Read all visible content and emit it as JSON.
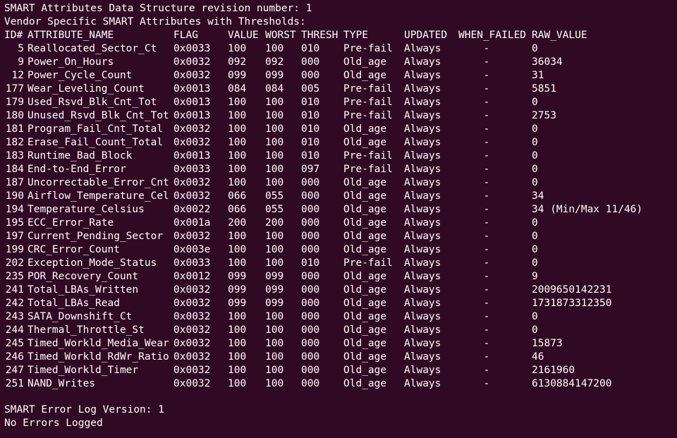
{
  "terminal": {
    "background": "#300a24",
    "foreground": "#ffffff",
    "lines_top": [
      "SMART Attributes Data Structure revision number: 1",
      "Vendor Specific SMART Attributes with Thresholds:"
    ],
    "header": {
      "id": "ID#",
      "name": "ATTRIBUTE_NAME",
      "flag": "FLAG",
      "value": "VALUE",
      "worst": "WORST",
      "thresh": "THRESH",
      "type": "TYPE",
      "updated": "UPDATED",
      "when_failed": "WHEN_FAILED",
      "raw": "RAW_VALUE"
    },
    "rows": [
      {
        "id": "5",
        "name": "Reallocated_Sector_Ct",
        "flag": "0x0033",
        "value": "100",
        "worst": "100",
        "thresh": "010",
        "type": "Pre-fail",
        "updated": "Always",
        "when_failed": "-",
        "raw": "0"
      },
      {
        "id": "9",
        "name": "Power_On_Hours",
        "flag": "0x0032",
        "value": "092",
        "worst": "092",
        "thresh": "000",
        "type": "Old_age",
        "updated": "Always",
        "when_failed": "-",
        "raw": "36034"
      },
      {
        "id": "12",
        "name": "Power_Cycle_Count",
        "flag": "0x0032",
        "value": "099",
        "worst": "099",
        "thresh": "000",
        "type": "Old_age",
        "updated": "Always",
        "when_failed": "-",
        "raw": "31"
      },
      {
        "id": "177",
        "name": "Wear_Leveling_Count",
        "flag": "0x0013",
        "value": "084",
        "worst": "084",
        "thresh": "005",
        "type": "Pre-fail",
        "updated": "Always",
        "when_failed": "-",
        "raw": "5851"
      },
      {
        "id": "179",
        "name": "Used_Rsvd_Blk_Cnt_Tot",
        "flag": "0x0013",
        "value": "100",
        "worst": "100",
        "thresh": "010",
        "type": "Pre-fail",
        "updated": "Always",
        "when_failed": "-",
        "raw": "0"
      },
      {
        "id": "180",
        "name": "Unused_Rsvd_Blk_Cnt_Tot",
        "flag": "0x0013",
        "value": "100",
        "worst": "100",
        "thresh": "010",
        "type": "Pre-fail",
        "updated": "Always",
        "when_failed": "-",
        "raw": "2753"
      },
      {
        "id": "181",
        "name": "Program_Fail_Cnt_Total",
        "flag": "0x0032",
        "value": "100",
        "worst": "100",
        "thresh": "010",
        "type": "Old_age",
        "updated": "Always",
        "when_failed": "-",
        "raw": "0"
      },
      {
        "id": "182",
        "name": "Erase_Fail_Count_Total",
        "flag": "0x0032",
        "value": "100",
        "worst": "100",
        "thresh": "010",
        "type": "Old_age",
        "updated": "Always",
        "when_failed": "-",
        "raw": "0"
      },
      {
        "id": "183",
        "name": "Runtime_Bad_Block",
        "flag": "0x0013",
        "value": "100",
        "worst": "100",
        "thresh": "010",
        "type": "Pre-fail",
        "updated": "Always",
        "when_failed": "-",
        "raw": "0"
      },
      {
        "id": "184",
        "name": "End-to-End_Error",
        "flag": "0x0033",
        "value": "100",
        "worst": "100",
        "thresh": "097",
        "type": "Pre-fail",
        "updated": "Always",
        "when_failed": "-",
        "raw": "0"
      },
      {
        "id": "187",
        "name": "Uncorrectable_Error_Cnt",
        "flag": "0x0032",
        "value": "100",
        "worst": "100",
        "thresh": "000",
        "type": "Old_age",
        "updated": "Always",
        "when_failed": "-",
        "raw": "0"
      },
      {
        "id": "190",
        "name": "Airflow_Temperature_Cel",
        "flag": "0x0032",
        "value": "066",
        "worst": "055",
        "thresh": "000",
        "type": "Old_age",
        "updated": "Always",
        "when_failed": "-",
        "raw": "34"
      },
      {
        "id": "194",
        "name": "Temperature_Celsius",
        "flag": "0x0022",
        "value": "066",
        "worst": "055",
        "thresh": "000",
        "type": "Old_age",
        "updated": "Always",
        "when_failed": "-",
        "raw": "34 (Min/Max 11/46)"
      },
      {
        "id": "195",
        "name": "ECC_Error_Rate",
        "flag": "0x001a",
        "value": "200",
        "worst": "200",
        "thresh": "000",
        "type": "Old_age",
        "updated": "Always",
        "when_failed": "-",
        "raw": "0"
      },
      {
        "id": "197",
        "name": "Current_Pending_Sector",
        "flag": "0x0032",
        "value": "100",
        "worst": "100",
        "thresh": "000",
        "type": "Old_age",
        "updated": "Always",
        "when_failed": "-",
        "raw": "0"
      },
      {
        "id": "199",
        "name": "CRC_Error_Count",
        "flag": "0x003e",
        "value": "100",
        "worst": "100",
        "thresh": "000",
        "type": "Old_age",
        "updated": "Always",
        "when_failed": "-",
        "raw": "0"
      },
      {
        "id": "202",
        "name": "Exception_Mode_Status",
        "flag": "0x0033",
        "value": "100",
        "worst": "100",
        "thresh": "010",
        "type": "Pre-fail",
        "updated": "Always",
        "when_failed": "-",
        "raw": "0"
      },
      {
        "id": "235",
        "name": "POR_Recovery_Count",
        "flag": "0x0012",
        "value": "099",
        "worst": "099",
        "thresh": "000",
        "type": "Old_age",
        "updated": "Always",
        "when_failed": "-",
        "raw": "9"
      },
      {
        "id": "241",
        "name": "Total_LBAs_Written",
        "flag": "0x0032",
        "value": "099",
        "worst": "099",
        "thresh": "000",
        "type": "Old_age",
        "updated": "Always",
        "when_failed": "-",
        "raw": "2009650142231"
      },
      {
        "id": "242",
        "name": "Total_LBAs_Read",
        "flag": "0x0032",
        "value": "099",
        "worst": "099",
        "thresh": "000",
        "type": "Old_age",
        "updated": "Always",
        "when_failed": "-",
        "raw": "1731873312350"
      },
      {
        "id": "243",
        "name": "SATA_Downshift_Ct",
        "flag": "0x0032",
        "value": "100",
        "worst": "100",
        "thresh": "000",
        "type": "Old_age",
        "updated": "Always",
        "when_failed": "-",
        "raw": "0"
      },
      {
        "id": "244",
        "name": "Thermal_Throttle_St",
        "flag": "0x0032",
        "value": "100",
        "worst": "100",
        "thresh": "000",
        "type": "Old_age",
        "updated": "Always",
        "when_failed": "-",
        "raw": "0"
      },
      {
        "id": "245",
        "name": "Timed_Workld_Media_Wear",
        "flag": "0x0032",
        "value": "100",
        "worst": "100",
        "thresh": "000",
        "type": "Old_age",
        "updated": "Always",
        "when_failed": "-",
        "raw": "15873"
      },
      {
        "id": "246",
        "name": "Timed_Workld_RdWr_Ratio",
        "flag": "0x0032",
        "value": "100",
        "worst": "100",
        "thresh": "000",
        "type": "Old_age",
        "updated": "Always",
        "when_failed": "-",
        "raw": "46"
      },
      {
        "id": "247",
        "name": "Timed_Workld_Timer",
        "flag": "0x0032",
        "value": "100",
        "worst": "100",
        "thresh": "000",
        "type": "Old_age",
        "updated": "Always",
        "when_failed": "-",
        "raw": "2161960"
      },
      {
        "id": "251",
        "name": "NAND_Writes",
        "flag": "0x0032",
        "value": "100",
        "worst": "100",
        "thresh": "000",
        "type": "Old_age",
        "updated": "Always",
        "when_failed": "-",
        "raw": "6130884147200"
      }
    ],
    "lines_bottom": [
      "SMART Error Log Version: 1",
      "No Errors Logged"
    ]
  }
}
